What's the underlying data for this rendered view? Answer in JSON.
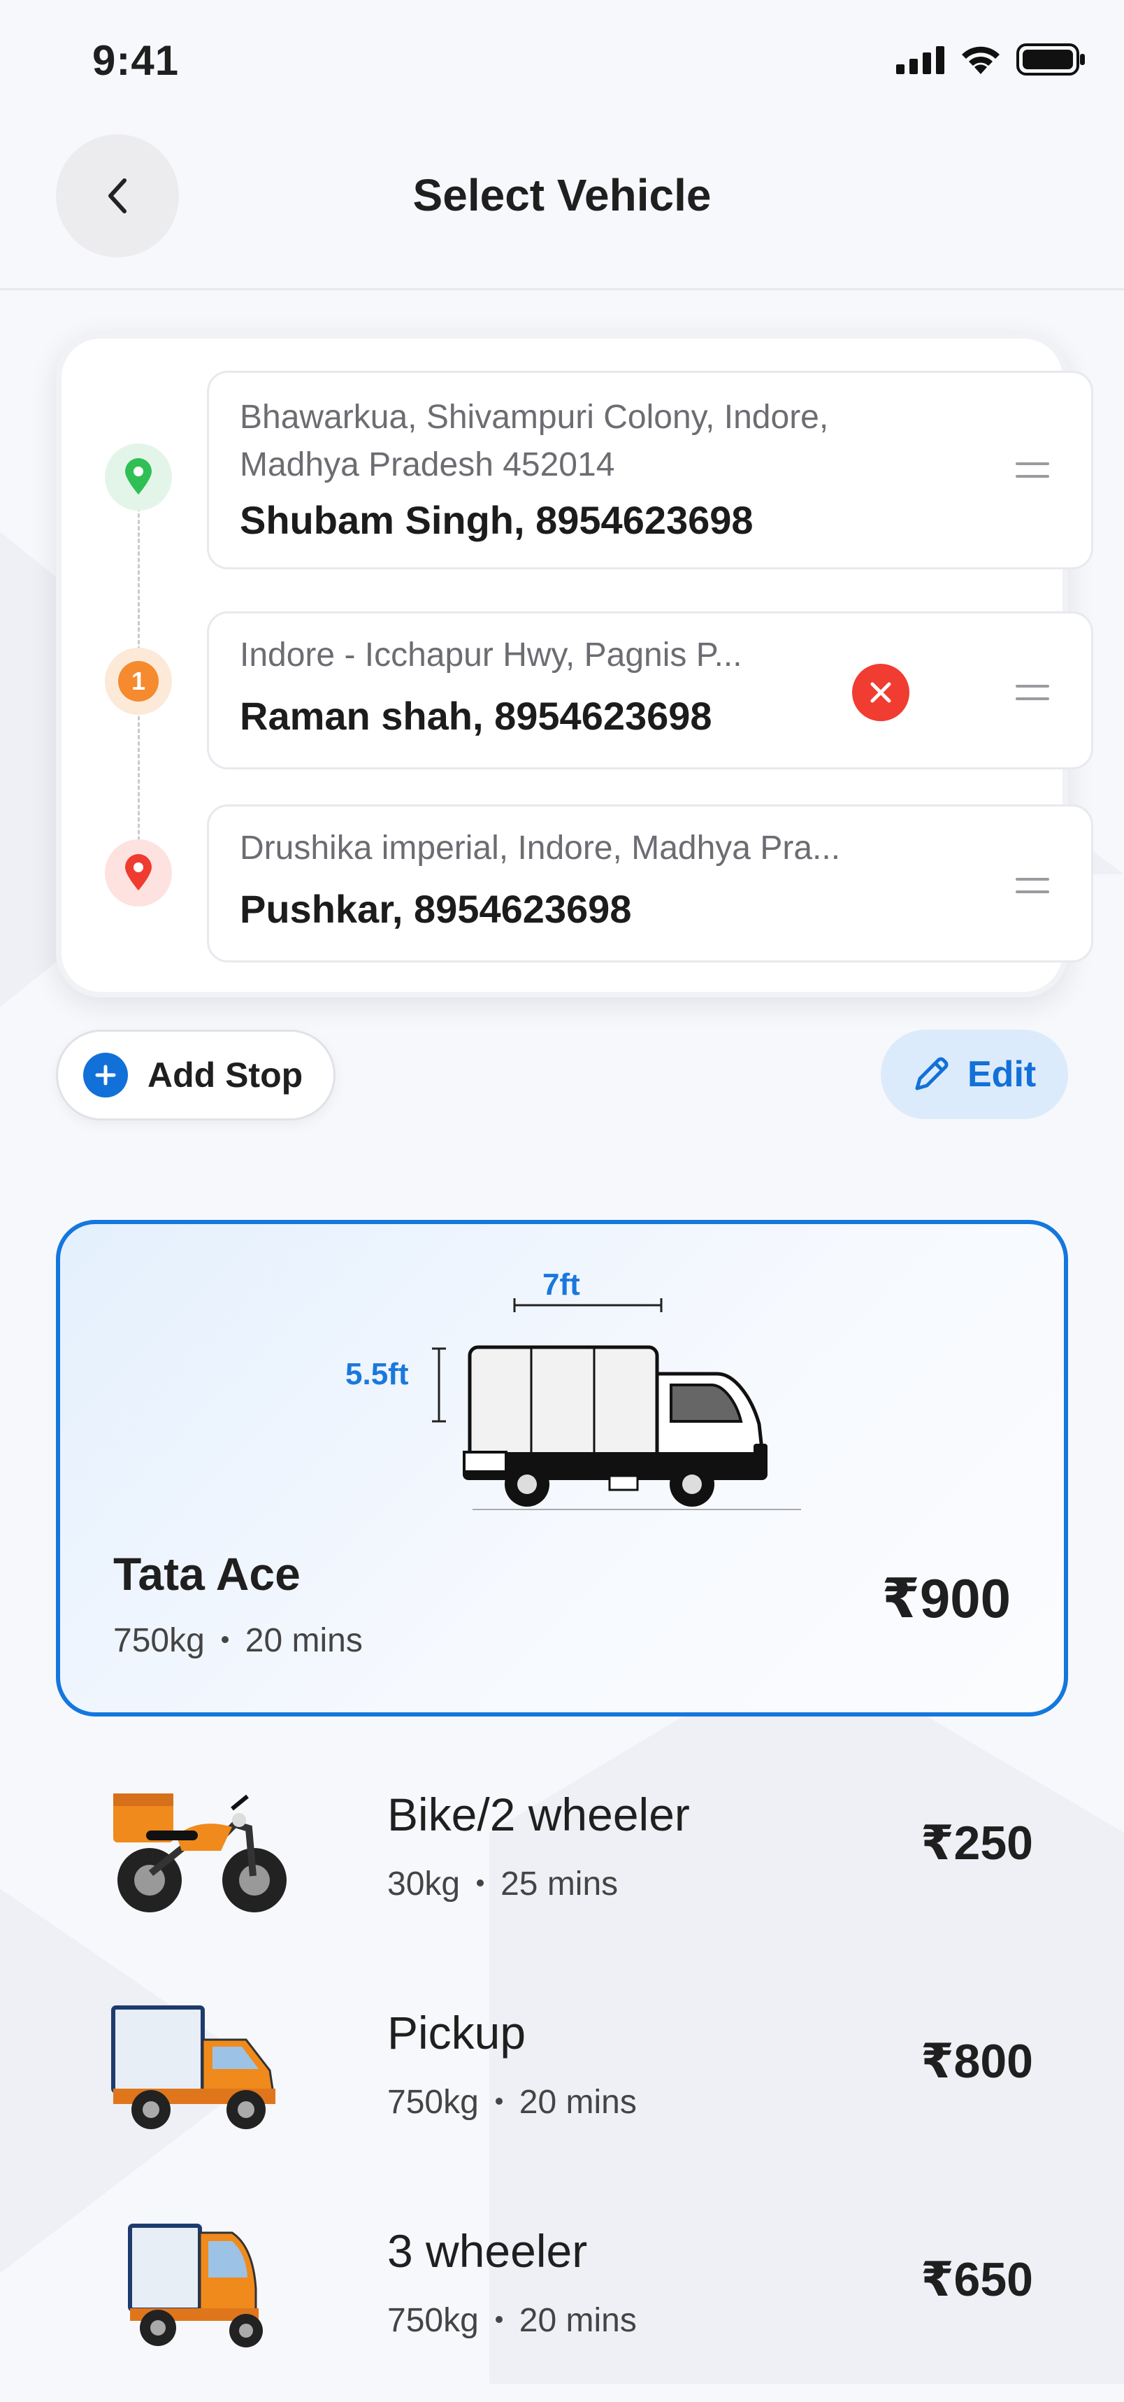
{
  "status_bar": {
    "time": "9:41"
  },
  "header": {
    "title": "Select Vehicle"
  },
  "route": {
    "stops": [
      {
        "address": "Bhawarkua, Shivampuri Colony, Indore, Madhya Pradesh 452014",
        "contact": "Shubam Singh, 8954623698",
        "marker": "pickup-pin-icon",
        "marker_color": "#2fbf54"
      },
      {
        "address": "Indore - Icchapur Hwy, Pagnis P...",
        "contact": "Raman shah, 8954623698",
        "marker": "stop-number",
        "marker_label": "1",
        "marker_color": "#f58a2e"
      },
      {
        "address": "Drushika imperial, Indore, Madhya Pra...",
        "contact": "Pushkar, 8954623698",
        "marker": "drop-pin-icon",
        "marker_color": "#ef3b30"
      }
    ]
  },
  "actions": {
    "add_stop": "Add Stop",
    "edit": "Edit"
  },
  "selected_vehicle": {
    "name": "Tata Ace",
    "weight": "750kg",
    "time": "20 mins",
    "price": "₹900",
    "width_label": "7ft",
    "height_label": "5.5ft",
    "accent_color": "#1477de"
  },
  "vehicles": [
    {
      "name": "Bike/2 wheeler",
      "weight": "30kg",
      "time": "25 mins",
      "price": "₹250",
      "icon": "bike-icon"
    },
    {
      "name": "Pickup",
      "weight": "750kg",
      "time": "20 mins",
      "price": "₹800",
      "icon": "pickup-truck-icon"
    },
    {
      "name": "3 wheeler",
      "weight": "750kg",
      "time": "20 mins",
      "price": "₹650",
      "icon": "three-wheeler-icon"
    }
  ]
}
